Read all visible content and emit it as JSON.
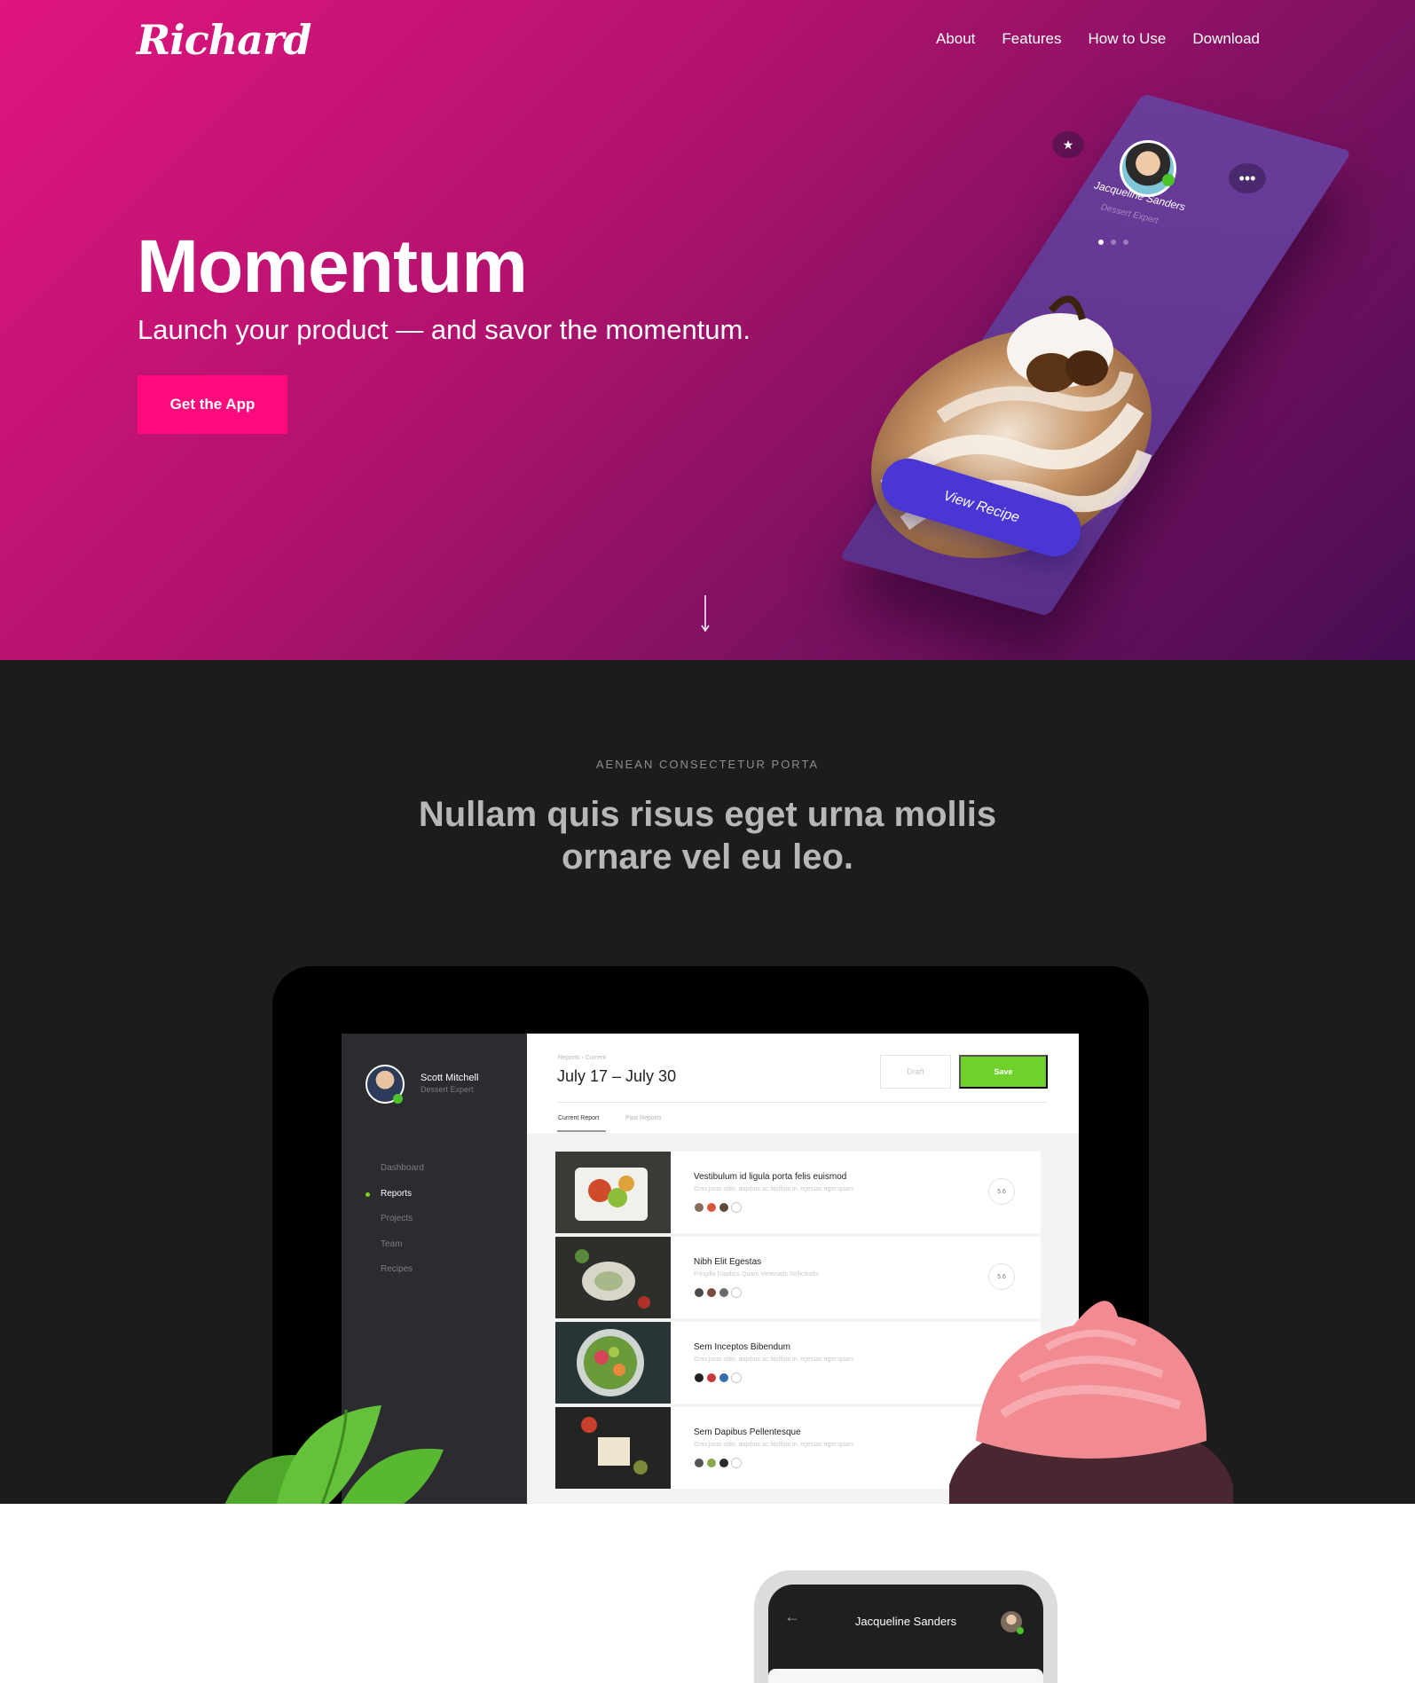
{
  "nav": {
    "logo": "Richard",
    "links": [
      "About",
      "Features",
      "How to Use",
      "Download"
    ]
  },
  "hero": {
    "title": "Momentum",
    "subtitle": "Launch your product — and savor the momentum.",
    "cta": "Get the App",
    "phone": {
      "user_name": "Jacqueline Sanders",
      "user_role": "Dessert Expert",
      "button": "View Recipe"
    }
  },
  "feature": {
    "eyebrow": "AENEAN CONSECTETUR PORTA",
    "title_line1": "Nullam quis risus eget urna mollis",
    "title_line2": "ornare vel eu leo."
  },
  "dashboard": {
    "user_name": "Scott Mitchell",
    "user_role": "Dessert Expert",
    "menu": [
      "Dashboard",
      "Reports",
      "Projects",
      "Team",
      "Recipes"
    ],
    "active_menu": "Reports",
    "breadcrumb": "Reports  ›  Current",
    "date_range": "July 17 – July 30",
    "draft_label": "Draft",
    "save_label": "Save",
    "tabs": [
      "Current Report",
      "Past Reports"
    ],
    "rows": [
      {
        "title": "Vestibulum id ligula porta felis euismod",
        "desc": "Cras justo odio, dapibus ac facilisis in, egestas eget quam.",
        "score": "5.6"
      },
      {
        "title": "Nibh Elit Egestas",
        "desc": "Fringilla Dapibus Quam Venenatis Sollicitudin",
        "score": "5.6"
      },
      {
        "title": "Sem Inceptos Bibendum",
        "desc": "Cras justo odio, dapibus ac facilisis in, egestas eget quam.",
        "score": ""
      },
      {
        "title": "Sem Dapibus Pellentesque",
        "desc": "Cras justo odio, dapibus ac facilisis in, egestas eget quam.",
        "score": ""
      }
    ]
  },
  "phone2": {
    "user_name": "Jacqueline Sanders"
  }
}
